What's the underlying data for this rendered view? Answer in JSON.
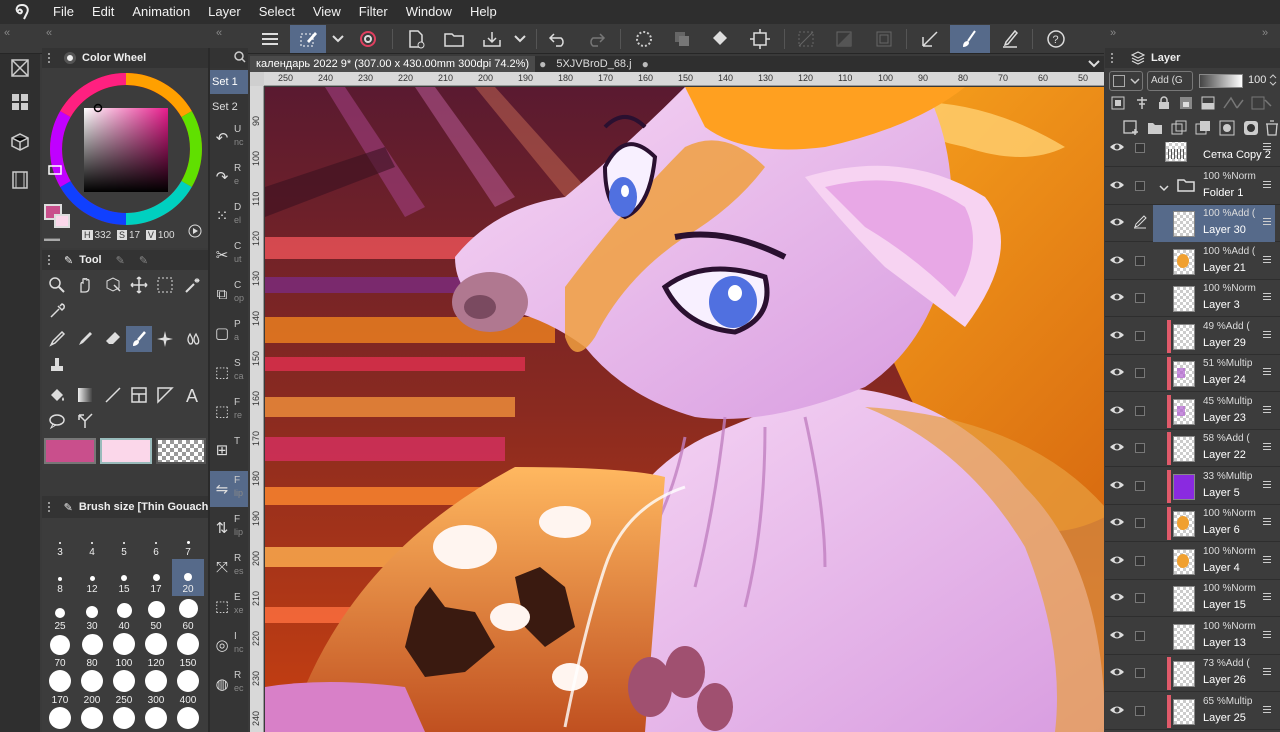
{
  "menu": [
    "File",
    "Edit",
    "Animation",
    "Layer",
    "Select",
    "View",
    "Filter",
    "Window",
    "Help"
  ],
  "colors": {
    "accent": "#566a8a",
    "main_color": "#c94f8c",
    "sub_color": "#fbd7ea"
  },
  "color_wheel": {
    "title": "Color Wheel",
    "h_label": "H",
    "h_value": "332",
    "s_label": "S",
    "s_value": "17",
    "v_label": "V",
    "v_value": "100"
  },
  "tool_panel": {
    "title": "Tool"
  },
  "brush_size": {
    "title": "Brush size [Thin Gouache",
    "sizes": [
      "3",
      "4",
      "5",
      "6",
      "7",
      "8",
      "12",
      "15",
      "17",
      "20",
      "25",
      "30",
      "40",
      "50",
      "60",
      "70",
      "80",
      "100",
      "120",
      "150",
      "170",
      "200",
      "250",
      "300",
      "400",
      "",
      "",
      "",
      "",
      ""
    ],
    "selected": "20"
  },
  "sub_tool": {
    "sets": [
      "Set 1",
      "Set 2"
    ],
    "items": [
      {
        "l1": "U",
        "l2": "nc"
      },
      {
        "l1": "R",
        "l2": "e"
      },
      {
        "l1": "D",
        "l2": "el"
      },
      {
        "l1": "C",
        "l2": "ut"
      },
      {
        "l1": "C",
        "l2": "op"
      },
      {
        "l1": "P",
        "l2": "a"
      },
      {
        "l1": "S",
        "l2": "ca"
      },
      {
        "l1": "F",
        "l2": "re"
      },
      {
        "l1": "T",
        "l2": ""
      },
      {
        "l1": "F",
        "l2": "lip"
      },
      {
        "l1": "F",
        "l2": "lip"
      },
      {
        "l1": "R",
        "l2": "es"
      },
      {
        "l1": "E",
        "l2": "xe"
      },
      {
        "l1": "I",
        "l2": "nc"
      },
      {
        "l1": "R",
        "l2": "ec"
      }
    ]
  },
  "document": {
    "active_tab": "календарь 2022 9* (307.00 x 430.00mm 300dpi 74.2%)",
    "other_tab": "5XJVBroD_68.j"
  },
  "ruler_h": [
    "250",
    "240",
    "230",
    "220",
    "210",
    "200",
    "190",
    "180",
    "170",
    "160",
    "150",
    "140",
    "130",
    "120",
    "110",
    "100",
    "90",
    "80",
    "70",
    "60",
    "50",
    "40"
  ],
  "ruler_v": [
    "90",
    "100",
    "110",
    "120",
    "130",
    "140",
    "150",
    "160",
    "170",
    "180",
    "190",
    "200",
    "210",
    "220",
    "230",
    "240"
  ],
  "layer_panel": {
    "title": "Layer",
    "blend_mode": "Add (G",
    "opacity": "100",
    "layers": [
      {
        "mode": "100 %Normal",
        "name": "Сетка Copy 2",
        "clip": false,
        "thumb": "grid"
      },
      {
        "mode": "100 %Norm",
        "name": "Folder 1",
        "clip": false,
        "thumb": "folder"
      },
      {
        "mode": "100 %Add (",
        "name": "Layer 30",
        "clip": false,
        "thumb": "blank",
        "active": true
      },
      {
        "mode": "100 %Add (",
        "name": "Layer 21",
        "clip": false,
        "thumb": "orange"
      },
      {
        "mode": "100 %Norm",
        "name": "Layer 3",
        "clip": false,
        "thumb": "blank"
      },
      {
        "mode": "49 %Add (",
        "name": "Layer 29",
        "clip": true,
        "thumb": "blank"
      },
      {
        "mode": "51 %Multip",
        "name": "Layer 24",
        "clip": true,
        "thumb": "purple-dot"
      },
      {
        "mode": "45 %Multip",
        "name": "Layer 23",
        "clip": true,
        "thumb": "purple-dot"
      },
      {
        "mode": "58 %Add (",
        "name": "Layer 22",
        "clip": true,
        "thumb": "blank"
      },
      {
        "mode": "33 %Multip",
        "name": "Layer 5",
        "clip": true,
        "thumb": "purple"
      },
      {
        "mode": "100 %Norm",
        "name": "Layer 6",
        "clip": true,
        "thumb": "orange"
      },
      {
        "mode": "100 %Norm",
        "name": "Layer 4",
        "clip": false,
        "thumb": "orange"
      },
      {
        "mode": "100 %Norm",
        "name": "Layer 15",
        "clip": false,
        "thumb": "blank"
      },
      {
        "mode": "100 %Norm",
        "name": "Layer 13",
        "clip": false,
        "thumb": "blank"
      },
      {
        "mode": "73 %Add (",
        "name": "Layer 26",
        "clip": true,
        "thumb": "blank"
      },
      {
        "mode": "65 %Multip",
        "name": "Layer 25",
        "clip": true,
        "thumb": "blank"
      }
    ]
  }
}
